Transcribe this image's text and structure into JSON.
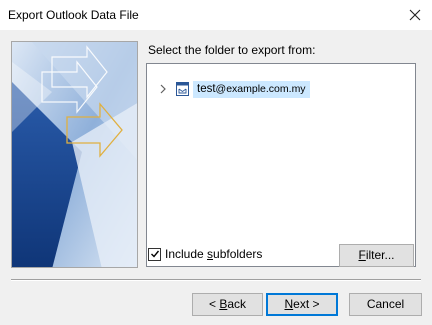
{
  "window": {
    "title": "Export Outlook Data File",
    "close_icon": "close-icon"
  },
  "main": {
    "prompt_prefix": "Select the folder to export from:",
    "tree": {
      "account_name": "test",
      "account_domain": "@example.com.my",
      "expander_icon": "chevron-right-icon",
      "account_icon": "mailbox-icon"
    },
    "include_subfolders": {
      "label_before": "Include ",
      "label_underlined": "s",
      "label_after": "ubfolders",
      "checked": true
    },
    "filter_button": {
      "label_underlined": "F",
      "label_after": "ilter..."
    }
  },
  "footer": {
    "back_button": {
      "label_before": "< ",
      "label_underlined": "B",
      "label_after": "ack"
    },
    "next_button": {
      "label_underlined": "N",
      "label_after": "ext >"
    },
    "cancel_button": {
      "label": "Cancel"
    }
  },
  "colors": {
    "dialog_bg": "#f0f0f0",
    "selection_bg": "#cce8ff",
    "default_button_border": "#0078d7",
    "art_blue": "#1f4e9c"
  }
}
